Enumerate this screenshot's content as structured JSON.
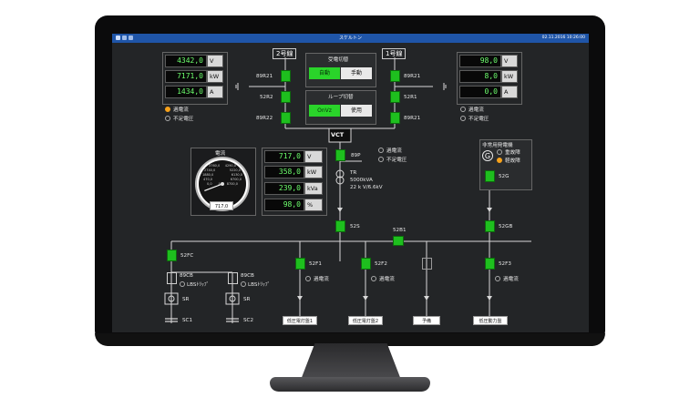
{
  "titlebar": {
    "title": "スケルトン",
    "datetime": "02.11.2016 10:26:00"
  },
  "lines": {
    "line2": "2号線",
    "line1": "1号線"
  },
  "left_meters": [
    {
      "value": "4342,0",
      "unit": "V"
    },
    {
      "value": "7171,0",
      "unit": "kW"
    },
    {
      "value": "1434,0",
      "unit": "A"
    }
  ],
  "right_meters": [
    {
      "value": "98,0",
      "unit": "V"
    },
    {
      "value": "8,0",
      "unit": "kW"
    },
    {
      "value": "0,0",
      "unit": "A"
    }
  ],
  "center_meters": [
    {
      "value": "717,0",
      "unit": "V"
    },
    {
      "value": "358,0",
      "unit": "kW"
    },
    {
      "value": "239,0",
      "unit": "kVa"
    },
    {
      "value": "98,0",
      "unit": "%"
    }
  ],
  "status_left": {
    "overcurrent": "過電流",
    "undervoltage": "不足電圧"
  },
  "status_right": {
    "overcurrent": "過電流",
    "undervoltage": "不足電圧"
  },
  "status_center": {
    "overcurrent": "過電流",
    "undervoltage": "不足電圧"
  },
  "receiving_switch": {
    "title": "受電切替",
    "auto": "自動",
    "manual": "手動"
  },
  "loop_switch": {
    "title": "ループ切替",
    "on": "OnVz",
    "use": "使用"
  },
  "breakers": {
    "b89R21_left": "89R21",
    "b52R2": "52R2",
    "b89R22": "89R22",
    "b89R21_right": "89R21",
    "b52R1": "52R1",
    "b89R21_right2": "89R21",
    "vct": "VCT",
    "b89P": "89P",
    "tr": "TR",
    "tr_rating": "5000kVA",
    "tr_voltage": "22 k V/6.6kV",
    "b52S": "52S",
    "b52B1": "52B1",
    "b52GB": "52GB",
    "b52G": "52G",
    "b52FC": "52FC",
    "b52F1": "52F1",
    "b52F2": "52F2",
    "b52F3": "52F3",
    "b89CB_1": "89CB",
    "b89CB_2": "89CB",
    "lbs1": "LBSﾄﾘｯﾌﾟ",
    "lbs2": "LBSﾄﾘｯﾌﾟ",
    "sr1": "SR",
    "sr2": "SR",
    "sc1": "SC1",
    "sc2": "SC2"
  },
  "feeder_status": {
    "f1": "過電流",
    "f2": "過電流",
    "f3": "過電流"
  },
  "generator": {
    "title": "非常用発電機",
    "heavy_fault": "重故障",
    "light_fault": "軽故障",
    "symbol": "G"
  },
  "gauge": {
    "title": "電流",
    "reading": "717,0",
    "ticks": [
      "3760,0",
      "4290,0",
      "2740,0",
      "5220,0",
      "1880,0",
      "6130,0",
      "470,0",
      "6700,0",
      "0,0",
      "8700,0"
    ],
    "unit": "A",
    "fraction": 0.09
  },
  "loads": {
    "l1": "低圧電灯盤1",
    "l2": "低圧電灯盤2",
    "spare": "予備",
    "power": "低圧動力盤"
  }
}
